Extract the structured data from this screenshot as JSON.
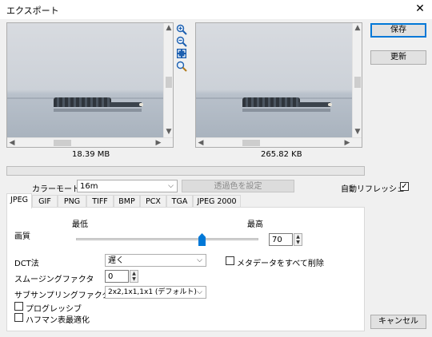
{
  "window": {
    "title": "エクスポート",
    "close_glyph": "✕"
  },
  "preview": {
    "original_size": "18.39 MB",
    "export_size": "265.82 KB",
    "tools": [
      "zoom-in-icon",
      "zoom-out-icon",
      "fit-icon",
      "actual-size-icon"
    ]
  },
  "buttons": {
    "save": "保存",
    "refresh": "更新",
    "cancel": "キャンセル",
    "transparent_color": "透過色を設定"
  },
  "color_mode": {
    "label": "カラーモード",
    "value": "16m"
  },
  "auto_refresh": {
    "label": "自動リフレッシュ",
    "checked": true,
    "check_glyph": "✓"
  },
  "tabs": [
    {
      "label": "JPEG",
      "active": true
    },
    {
      "label": "GIF"
    },
    {
      "label": "PNG"
    },
    {
      "label": "TIFF"
    },
    {
      "label": "BMP"
    },
    {
      "label": "PCX"
    },
    {
      "label": "TGA"
    },
    {
      "label": "JPEG 2000"
    }
  ],
  "jpeg": {
    "quality_label": "画質",
    "quality_min_label": "最低",
    "quality_max_label": "最高",
    "quality_value": "70",
    "quality_fraction": 0.7,
    "dct_label": "DCT法",
    "dct_value": "遅く",
    "smoothing_label": "スムージングファクタ",
    "smoothing_value": "0",
    "subsampling_label": "サブサンプリングファクタ",
    "subsampling_value": "2x2,1x1,1x1 (デフォルト)",
    "progressive_label": "プログレッシブ",
    "progressive_checked": false,
    "huffman_label": "ハフマン表最適化",
    "huffman_checked": false,
    "remove_metadata_label": "メタデータをすべて削除",
    "remove_metadata_checked": false
  },
  "colors": {
    "accent": "#0078d7",
    "zoom_icon": "#1c5fb0"
  }
}
